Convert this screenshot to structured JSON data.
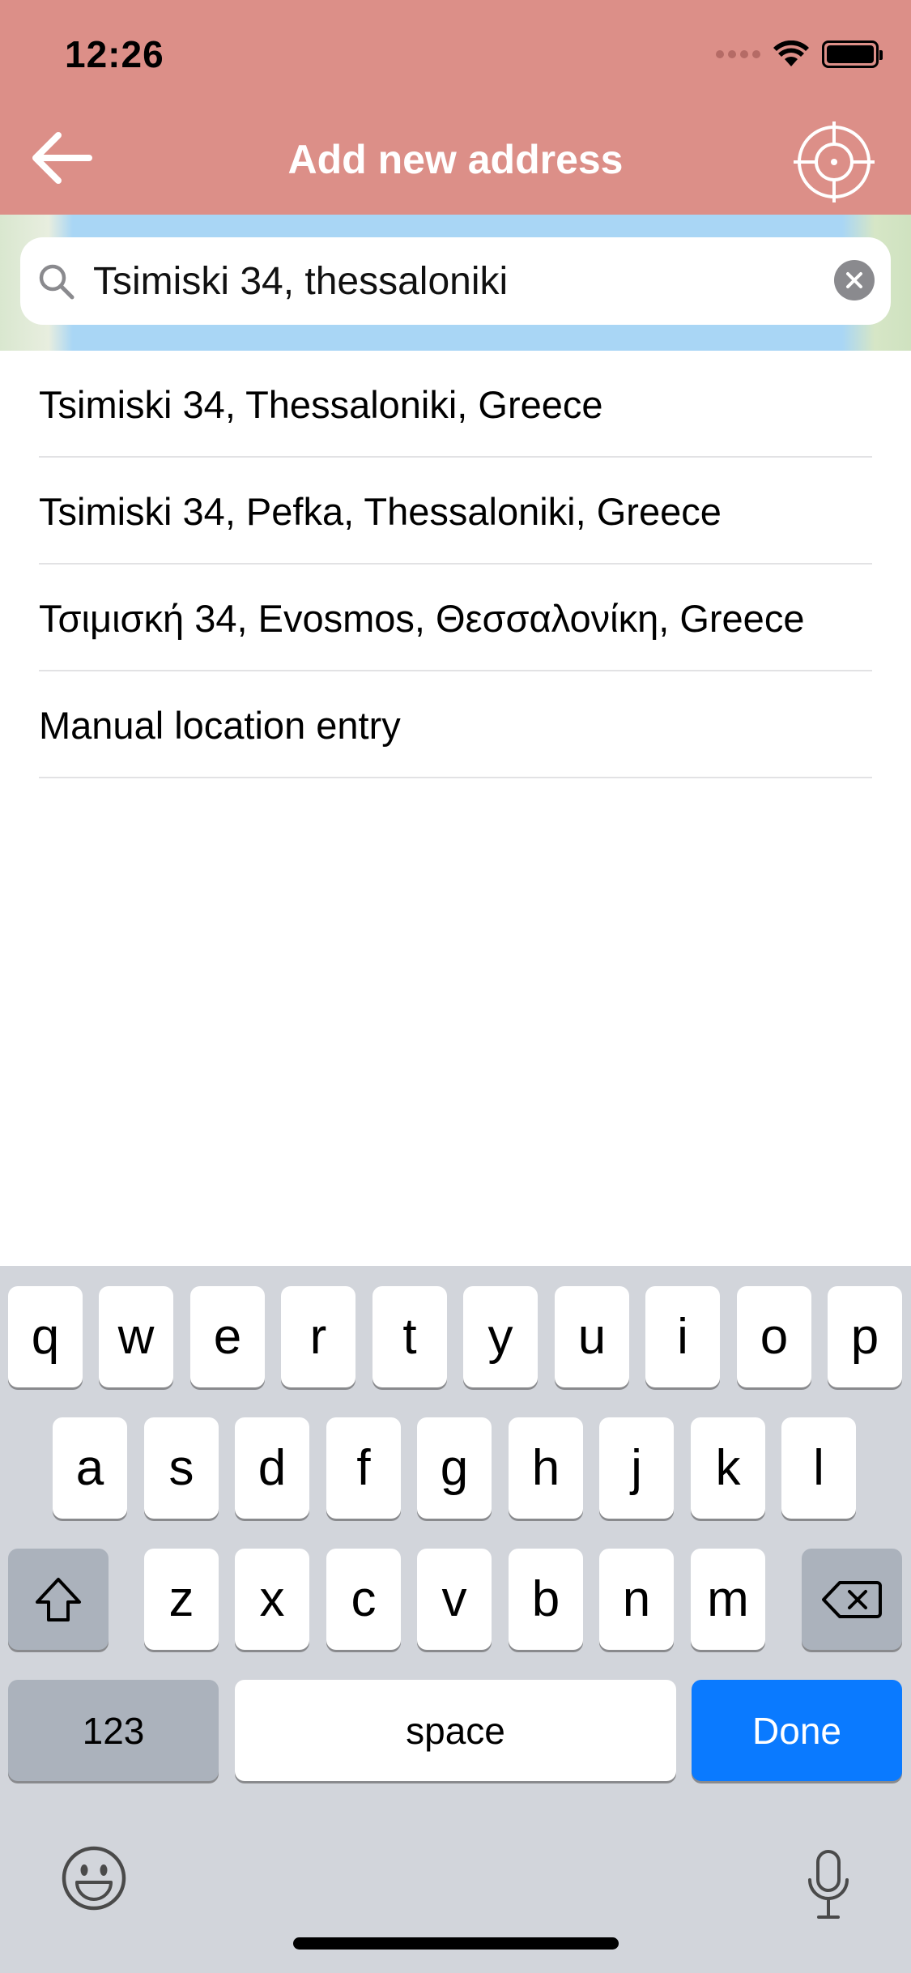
{
  "status_bar": {
    "time": "12:26"
  },
  "header": {
    "title": "Add new address",
    "background": "#dc8f88"
  },
  "search": {
    "value": "Tsimiski 34, thessaloniki"
  },
  "results": [
    {
      "label": "Tsimiski 34, Thessaloniki, Greece"
    },
    {
      "label": "Tsimiski 34, Pefka, Thessaloniki, Greece"
    },
    {
      "label": "Τσιμισκή 34, Evosmos, Θεσσαλονίκη, Greece"
    },
    {
      "label": "Manual location entry"
    }
  ],
  "keyboard": {
    "row1": [
      "q",
      "w",
      "e",
      "r",
      "t",
      "y",
      "u",
      "i",
      "o",
      "p"
    ],
    "row2": [
      "a",
      "s",
      "d",
      "f",
      "g",
      "h",
      "j",
      "k",
      "l"
    ],
    "row3": [
      "z",
      "x",
      "c",
      "v",
      "b",
      "n",
      "m"
    ],
    "numbers_label": "123",
    "space_label": "space",
    "done_label": "Done",
    "accent": "#0a7aff"
  }
}
